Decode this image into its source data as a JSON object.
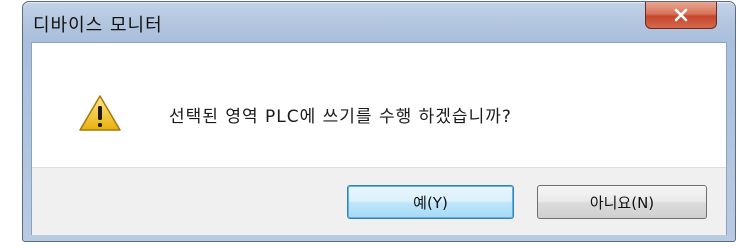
{
  "dialog": {
    "title": "디바이스 모니터",
    "message": "선택된 영역 PLC에 쓰기를 수행 하겠습니까?",
    "icon": "warning-icon",
    "buttons": {
      "yes_label": "예(Y)",
      "no_label": "아니요(N)"
    },
    "colors": {
      "close_button": "#c84a30",
      "default_button_border": "#3c7fb1",
      "warning_fill": "#f3c41d"
    }
  }
}
